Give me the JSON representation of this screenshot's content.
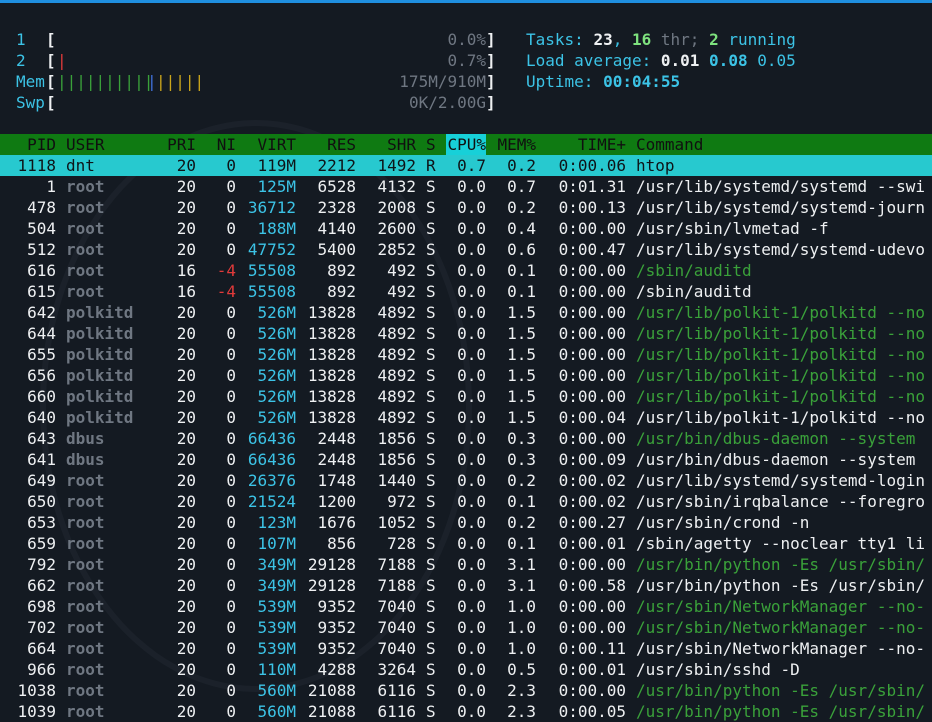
{
  "meters": [
    {
      "label": "1",
      "bar": "",
      "percent": "0.0%"
    },
    {
      "label": "2",
      "bar": "|",
      "percent": "0.7%"
    }
  ],
  "mem": {
    "label": "Mem",
    "bar_green": "||||||||||",
    "bar_blue": "|",
    "bar_yellow": "|||||",
    "value": "175M/910M"
  },
  "swp": {
    "label": "Swp",
    "bar": "",
    "value": "0K/2.00G"
  },
  "tasks": {
    "label": "Tasks:",
    "count": "23",
    "sep": ",",
    "thr": "16",
    "thr_label": "thr;",
    "running": "2",
    "running_label": "running"
  },
  "load": {
    "label": "Load average:",
    "l1": "0.01",
    "l5": "0.08",
    "l15": "0.05"
  },
  "uptime": {
    "label": "Uptime:",
    "value": "00:04:55"
  },
  "header": {
    "pid": "PID",
    "user": "USER",
    "pri": "PRI",
    "ni": "NI",
    "virt": "VIRT",
    "res": "RES",
    "shr": "SHR",
    "s": "S",
    "cpu": "CPU%",
    "mem": "MEM%",
    "time": "TIME+",
    "command": "Command"
  },
  "processes": [
    {
      "pid": "1118",
      "user": "dnt",
      "pri": "20",
      "ni": "0",
      "virt": "119M",
      "res": "2212",
      "shr": "1492",
      "s": "R",
      "cpu": "0.7",
      "mem": "0.2",
      "time": "0:00.06",
      "command": "htop",
      "thread": false
    },
    {
      "pid": "1",
      "user": "root",
      "pri": "20",
      "ni": "0",
      "virt": "125M",
      "res": "6528",
      "shr": "4132",
      "s": "S",
      "cpu": "0.0",
      "mem": "0.7",
      "time": "0:01.31",
      "command": "/usr/lib/systemd/systemd --swi",
      "thread": false
    },
    {
      "pid": "478",
      "user": "root",
      "pri": "20",
      "ni": "0",
      "virt": "36712",
      "res": "2328",
      "shr": "2008",
      "s": "S",
      "cpu": "0.0",
      "mem": "0.2",
      "time": "0:00.13",
      "command": "/usr/lib/systemd/systemd-journ",
      "thread": false
    },
    {
      "pid": "504",
      "user": "root",
      "pri": "20",
      "ni": "0",
      "virt": "188M",
      "res": "4140",
      "shr": "2600",
      "s": "S",
      "cpu": "0.0",
      "mem": "0.4",
      "time": "0:00.00",
      "command": "/usr/sbin/lvmetad -f",
      "thread": false
    },
    {
      "pid": "512",
      "user": "root",
      "pri": "20",
      "ni": "0",
      "virt": "47752",
      "res": "5400",
      "shr": "2852",
      "s": "S",
      "cpu": "0.0",
      "mem": "0.6",
      "time": "0:00.47",
      "command": "/usr/lib/systemd/systemd-udevo",
      "thread": false
    },
    {
      "pid": "616",
      "user": "root",
      "pri": "16",
      "ni": "-4",
      "virt": "55508",
      "res": "892",
      "shr": "492",
      "s": "S",
      "cpu": "0.0",
      "mem": "0.1",
      "time": "0:00.00",
      "command": "/sbin/auditd",
      "thread": true
    },
    {
      "pid": "615",
      "user": "root",
      "pri": "16",
      "ni": "-4",
      "virt": "55508",
      "res": "892",
      "shr": "492",
      "s": "S",
      "cpu": "0.0",
      "mem": "0.1",
      "time": "0:00.00",
      "command": "/sbin/auditd",
      "thread": false
    },
    {
      "pid": "642",
      "user": "polkitd",
      "pri": "20",
      "ni": "0",
      "virt": "526M",
      "res": "13828",
      "shr": "4892",
      "s": "S",
      "cpu": "0.0",
      "mem": "1.5",
      "time": "0:00.00",
      "command": "/usr/lib/polkit-1/polkitd --no",
      "thread": true
    },
    {
      "pid": "644",
      "user": "polkitd",
      "pri": "20",
      "ni": "0",
      "virt": "526M",
      "res": "13828",
      "shr": "4892",
      "s": "S",
      "cpu": "0.0",
      "mem": "1.5",
      "time": "0:00.00",
      "command": "/usr/lib/polkit-1/polkitd --no",
      "thread": true
    },
    {
      "pid": "655",
      "user": "polkitd",
      "pri": "20",
      "ni": "0",
      "virt": "526M",
      "res": "13828",
      "shr": "4892",
      "s": "S",
      "cpu": "0.0",
      "mem": "1.5",
      "time": "0:00.00",
      "command": "/usr/lib/polkit-1/polkitd --no",
      "thread": true
    },
    {
      "pid": "656",
      "user": "polkitd",
      "pri": "20",
      "ni": "0",
      "virt": "526M",
      "res": "13828",
      "shr": "4892",
      "s": "S",
      "cpu": "0.0",
      "mem": "1.5",
      "time": "0:00.00",
      "command": "/usr/lib/polkit-1/polkitd --no",
      "thread": true
    },
    {
      "pid": "660",
      "user": "polkitd",
      "pri": "20",
      "ni": "0",
      "virt": "526M",
      "res": "13828",
      "shr": "4892",
      "s": "S",
      "cpu": "0.0",
      "mem": "1.5",
      "time": "0:00.00",
      "command": "/usr/lib/polkit-1/polkitd --no",
      "thread": true
    },
    {
      "pid": "640",
      "user": "polkitd",
      "pri": "20",
      "ni": "0",
      "virt": "526M",
      "res": "13828",
      "shr": "4892",
      "s": "S",
      "cpu": "0.0",
      "mem": "1.5",
      "time": "0:00.04",
      "command": "/usr/lib/polkit-1/polkitd --no",
      "thread": false
    },
    {
      "pid": "643",
      "user": "dbus",
      "pri": "20",
      "ni": "0",
      "virt": "66436",
      "res": "2448",
      "shr": "1856",
      "s": "S",
      "cpu": "0.0",
      "mem": "0.3",
      "time": "0:00.00",
      "command": "/usr/bin/dbus-daemon --system",
      "thread": true
    },
    {
      "pid": "641",
      "user": "dbus",
      "pri": "20",
      "ni": "0",
      "virt": "66436",
      "res": "2448",
      "shr": "1856",
      "s": "S",
      "cpu": "0.0",
      "mem": "0.3",
      "time": "0:00.09",
      "command": "/usr/bin/dbus-daemon --system",
      "thread": false
    },
    {
      "pid": "649",
      "user": "root",
      "pri": "20",
      "ni": "0",
      "virt": "26376",
      "res": "1748",
      "shr": "1440",
      "s": "S",
      "cpu": "0.0",
      "mem": "0.2",
      "time": "0:00.02",
      "command": "/usr/lib/systemd/systemd-login",
      "thread": false
    },
    {
      "pid": "650",
      "user": "root",
      "pri": "20",
      "ni": "0",
      "virt": "21524",
      "res": "1200",
      "shr": "972",
      "s": "S",
      "cpu": "0.0",
      "mem": "0.1",
      "time": "0:00.02",
      "command": "/usr/sbin/irqbalance --foregro",
      "thread": false
    },
    {
      "pid": "653",
      "user": "root",
      "pri": "20",
      "ni": "0",
      "virt": "123M",
      "res": "1676",
      "shr": "1052",
      "s": "S",
      "cpu": "0.0",
      "mem": "0.2",
      "time": "0:00.27",
      "command": "/usr/sbin/crond -n",
      "thread": false
    },
    {
      "pid": "659",
      "user": "root",
      "pri": "20",
      "ni": "0",
      "virt": "107M",
      "res": "856",
      "shr": "728",
      "s": "S",
      "cpu": "0.0",
      "mem": "0.1",
      "time": "0:00.01",
      "command": "/sbin/agetty --noclear tty1 li",
      "thread": false
    },
    {
      "pid": "792",
      "user": "root",
      "pri": "20",
      "ni": "0",
      "virt": "349M",
      "res": "29128",
      "shr": "7188",
      "s": "S",
      "cpu": "0.0",
      "mem": "3.1",
      "time": "0:00.00",
      "command": "/usr/bin/python -Es /usr/sbin/",
      "thread": true
    },
    {
      "pid": "662",
      "user": "root",
      "pri": "20",
      "ni": "0",
      "virt": "349M",
      "res": "29128",
      "shr": "7188",
      "s": "S",
      "cpu": "0.0",
      "mem": "3.1",
      "time": "0:00.58",
      "command": "/usr/bin/python -Es /usr/sbin/",
      "thread": false
    },
    {
      "pid": "698",
      "user": "root",
      "pri": "20",
      "ni": "0",
      "virt": "539M",
      "res": "9352",
      "shr": "7040",
      "s": "S",
      "cpu": "0.0",
      "mem": "1.0",
      "time": "0:00.00",
      "command": "/usr/sbin/NetworkManager --no-",
      "thread": true
    },
    {
      "pid": "702",
      "user": "root",
      "pri": "20",
      "ni": "0",
      "virt": "539M",
      "res": "9352",
      "shr": "7040",
      "s": "S",
      "cpu": "0.0",
      "mem": "1.0",
      "time": "0:00.00",
      "command": "/usr/sbin/NetworkManager --no-",
      "thread": true
    },
    {
      "pid": "664",
      "user": "root",
      "pri": "20",
      "ni": "0",
      "virt": "539M",
      "res": "9352",
      "shr": "7040",
      "s": "S",
      "cpu": "0.0",
      "mem": "1.0",
      "time": "0:00.11",
      "command": "/usr/sbin/NetworkManager --no-",
      "thread": false
    },
    {
      "pid": "966",
      "user": "root",
      "pri": "20",
      "ni": "0",
      "virt": "110M",
      "res": "4288",
      "shr": "3264",
      "s": "S",
      "cpu": "0.0",
      "mem": "0.5",
      "time": "0:00.01",
      "command": "/usr/sbin/sshd -D",
      "thread": false
    },
    {
      "pid": "1038",
      "user": "root",
      "pri": "20",
      "ni": "0",
      "virt": "560M",
      "res": "21088",
      "shr": "6116",
      "s": "S",
      "cpu": "0.0",
      "mem": "2.3",
      "time": "0:00.00",
      "command": "/usr/bin/python -Es /usr/sbin/",
      "thread": true
    },
    {
      "pid": "1039",
      "user": "root",
      "pri": "20",
      "ni": "0",
      "virt": "560M",
      "res": "21088",
      "shr": "6116",
      "s": "S",
      "cpu": "0.0",
      "mem": "2.3",
      "time": "0:00.05",
      "command": "/usr/bin/python -Es /usr/sbin/",
      "thread": true
    }
  ]
}
